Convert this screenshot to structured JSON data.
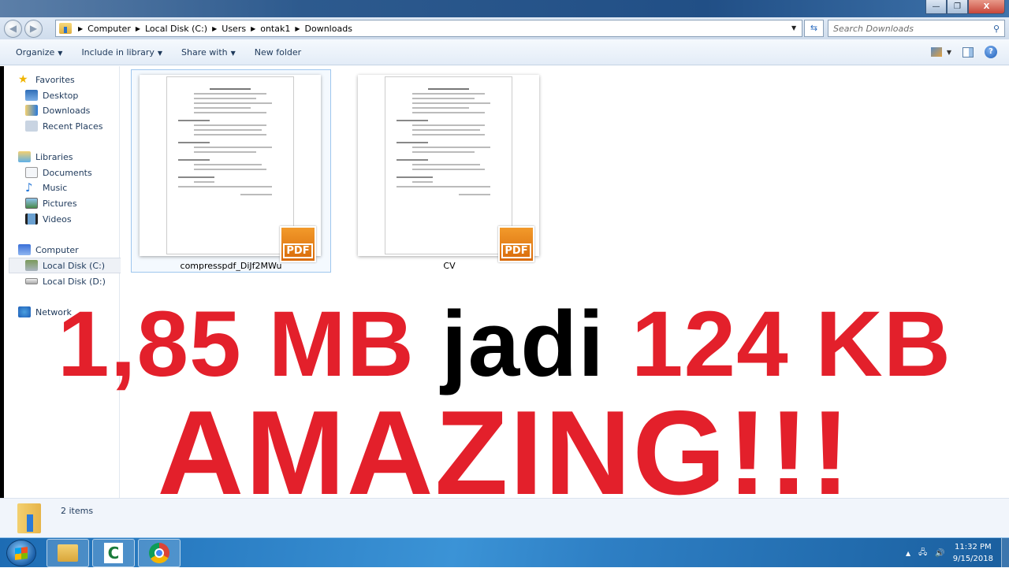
{
  "window": {
    "controls": {
      "minimize": "—",
      "maximize": "❐",
      "close": "X"
    }
  },
  "address": {
    "crumbs": [
      "Computer",
      "Local Disk (C:)",
      "Users",
      "ontak1",
      "Downloads"
    ],
    "search_placeholder": "Search Downloads"
  },
  "toolbar": {
    "organize": "Organize",
    "include_in_library": "Include in library",
    "share_with": "Share with",
    "new_folder": "New folder"
  },
  "sidebar": {
    "favorites": {
      "label": "Favorites",
      "items": [
        "Desktop",
        "Downloads",
        "Recent Places"
      ]
    },
    "libraries": {
      "label": "Libraries",
      "items": [
        "Documents",
        "Music",
        "Pictures",
        "Videos"
      ]
    },
    "computer": {
      "label": "Computer",
      "items": [
        "Local Disk (C:)",
        "Local Disk (D:)"
      ],
      "selected": "Local Disk (C:)"
    },
    "network": {
      "label": "Network"
    }
  },
  "files": [
    {
      "name": "compresspdf_DiJf2MWu",
      "badge": "PDF",
      "selected": true
    },
    {
      "name": "CV",
      "badge": "PDF",
      "selected": false
    }
  ],
  "overlay": {
    "line1_a": "1,85 MB",
    "line1_b": "jadi",
    "line1_c": "124 KB",
    "line2": "AMAZING!!!",
    "accent_color": "#e3202b"
  },
  "status": {
    "count": "2 items"
  },
  "taskbar": {
    "apps": [
      "windows-explorer",
      "camtasia",
      "chrome"
    ],
    "time": "11:32 PM",
    "date": "9/15/2018"
  }
}
